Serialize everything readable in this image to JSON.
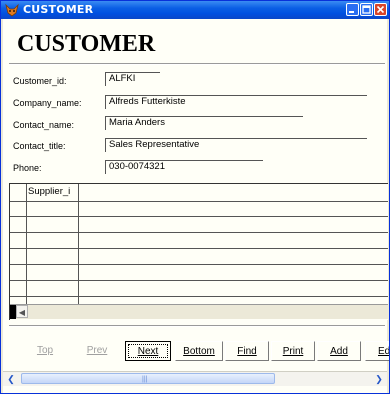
{
  "window": {
    "title": "CUSTOMER"
  },
  "form": {
    "title": "CUSTOMER",
    "fields": [
      {
        "label": "Customer_id:",
        "value": "ALFKI"
      },
      {
        "label": "Company_name:",
        "value": "Alfreds Futterkiste"
      },
      {
        "label": "Contact_name:",
        "value": "Maria Anders"
      },
      {
        "label": "Contact_title:",
        "value": "Sales Representative"
      },
      {
        "label": "Phone:",
        "value": "030-0074321"
      }
    ]
  },
  "grid": {
    "column_header": "Supplier_i",
    "scroll_left_icon": "arrow-left-icon"
  },
  "nav": {
    "top": "Top",
    "prev": "Prev",
    "next": "Next",
    "bottom": "Bottom",
    "find": "Find",
    "print": "Print",
    "add": "Add",
    "edit": "Ed"
  },
  "colors": {
    "title_bar": "#0a5ee4",
    "form_bg": "#fffff7",
    "close_button": "#d8452a"
  }
}
